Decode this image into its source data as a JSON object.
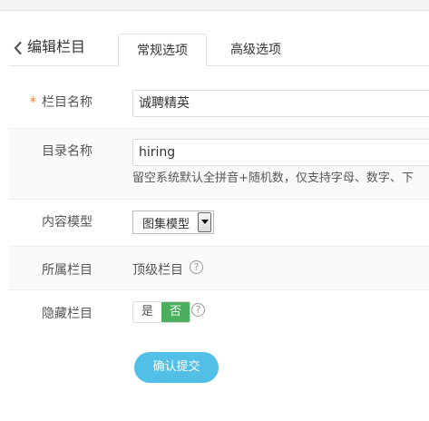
{
  "header": {
    "back_icon": "chevron-left-icon",
    "title": "编辑栏目",
    "tabs": [
      {
        "label": "常规选项",
        "active": true
      },
      {
        "label": "高级选项",
        "active": false
      }
    ]
  },
  "form": {
    "name": {
      "required_mark": "*",
      "label": "栏目名称",
      "value": "诚聘精英"
    },
    "dir": {
      "label": "目录名称",
      "value": "hiring",
      "hint": "留空系统默认全拼音+随机数，仅支持字母、数字、下"
    },
    "model": {
      "label": "内容模型",
      "selected": "图集模型"
    },
    "parent": {
      "label": "所属栏目",
      "value": "顶级栏目",
      "help_icon": "question-circle-icon"
    },
    "hidden": {
      "label": "隐藏栏目",
      "options": [
        "是",
        "否"
      ],
      "selected": "否",
      "help_icon": "question-circle-icon"
    }
  },
  "submit_label": "确认提交",
  "colors": {
    "required": "#f07c2a",
    "toggle_on": "#4cae5f",
    "submit": "#51bfe6"
  }
}
